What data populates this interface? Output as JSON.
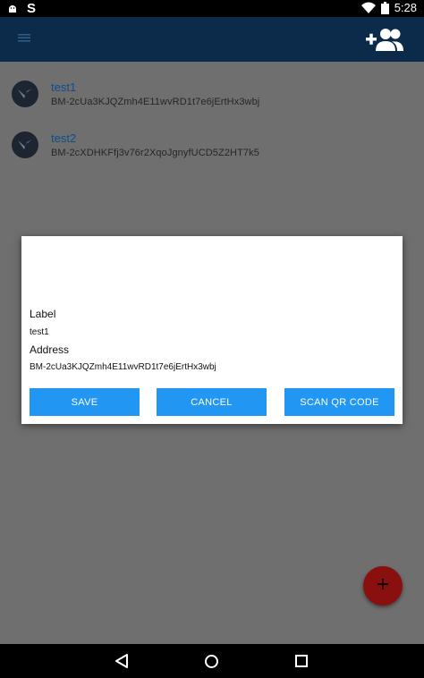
{
  "status_bar": {
    "time": "5:28",
    "left_icons": [
      "android-icon",
      "s-app-icon"
    ],
    "right_icons": [
      "wifi-icon",
      "battery-icon"
    ],
    "s_glyph": "S"
  },
  "toolbar": {
    "menu_icon": "hamburger-icon",
    "add_contact_icon": "add-group-icon"
  },
  "contacts": [
    {
      "name": "test1",
      "address": "BM-2cUa3KJQZmh4E11wvRD1t7e6jErtHx3wbj"
    },
    {
      "name": "test2",
      "address": "BM-2cXDHKFfj3v76r2XqoJgnyfUCD5Z2HT7k5"
    }
  ],
  "dialog": {
    "label_heading": "Label",
    "label_value": "test1",
    "address_heading": "Address",
    "address_value": "BM-2cUa3KJQZmh4E11wvRD1t7e6jErtHx3wbj",
    "buttons": {
      "save": "SAVE",
      "cancel": "CANCEL",
      "scan": "SCAN QR CODE"
    }
  },
  "fab": {
    "icon": "plus-icon",
    "glyph": "+"
  },
  "colors": {
    "toolbar": "#0c2b4a",
    "accent_button": "#2196f3",
    "fab": "#8a1010",
    "scrim": "#6f6f6f"
  }
}
